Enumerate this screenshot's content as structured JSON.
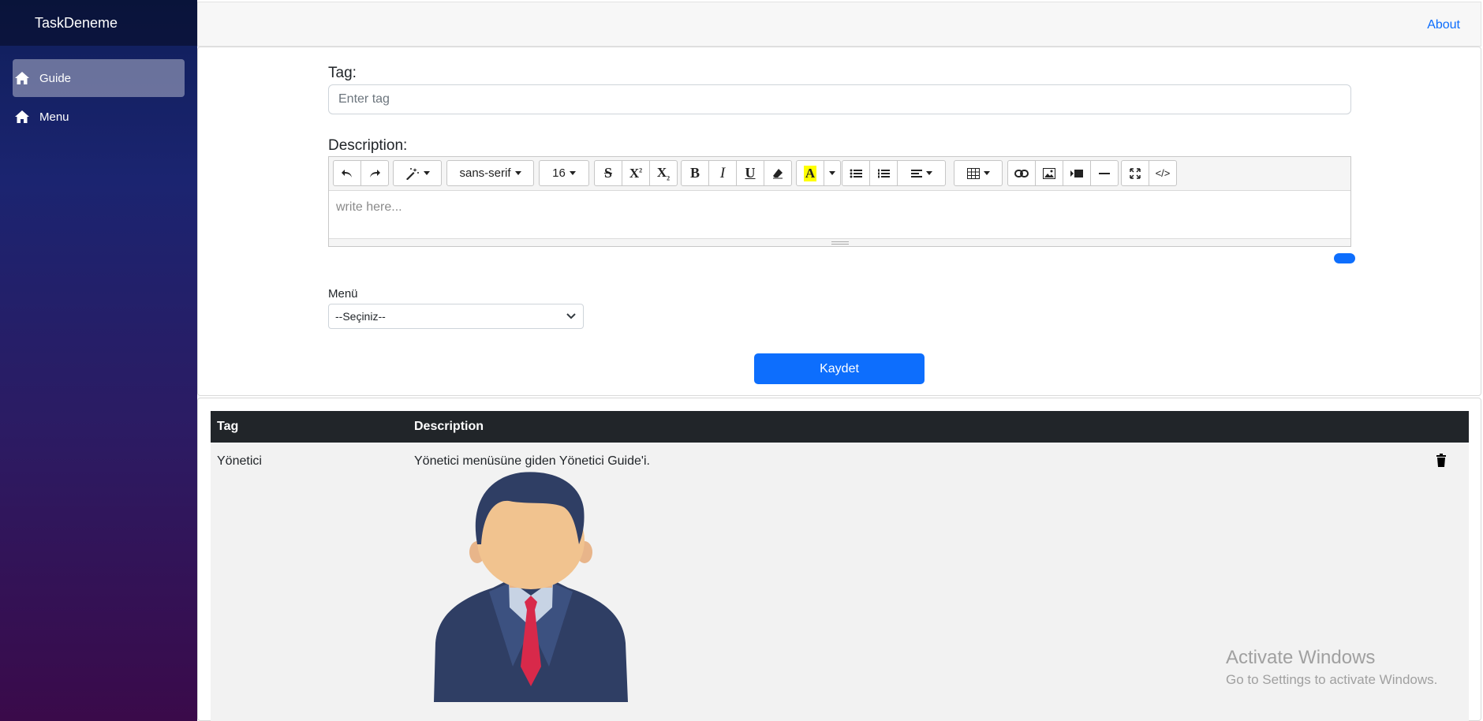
{
  "app": {
    "title": "TaskDeneme"
  },
  "sidebar": {
    "items": [
      {
        "label": "Guide",
        "icon": "home-icon",
        "active": true
      },
      {
        "label": "Menu",
        "icon": "home-icon",
        "active": false
      }
    ]
  },
  "topbar": {
    "about_label": "About"
  },
  "form": {
    "tag_label": "Tag:",
    "tag_placeholder": "Enter tag",
    "tag_value": "",
    "description_label": "Description:",
    "editor": {
      "font_name": "sans-serif",
      "font_size": "16",
      "placeholder": "write here...",
      "toolbar_icons": [
        "undo-icon",
        "redo-icon",
        "style-wand-icon",
        "font-name-dropdown",
        "font-size-dropdown",
        "strikethrough-icon",
        "superscript-icon",
        "subscript-icon",
        "bold-icon",
        "italic-icon",
        "underline-icon",
        "eraser-icon",
        "text-color-icon",
        "unordered-list-icon",
        "ordered-list-icon",
        "align-icon",
        "table-icon",
        "link-icon",
        "image-icon",
        "video-icon",
        "horizontal-rule-icon",
        "fullscreen-icon",
        "code-view-icon"
      ]
    },
    "menu_label": "Menü",
    "menu_select": {
      "selected": "--Seçiniz--"
    },
    "save_label": "Kaydet",
    "accent": "#0d6efd"
  },
  "table": {
    "headers": [
      "Tag",
      "Description"
    ],
    "rows": [
      {
        "tag": "Yönetici",
        "description": "Yönetici menüsüne giden Yönetici Guide'i."
      }
    ]
  },
  "watermark": {
    "line1": "Activate Windows",
    "line2": "Go to Settings to activate Windows."
  }
}
